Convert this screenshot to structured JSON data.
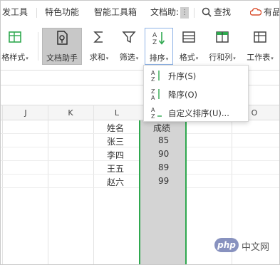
{
  "menubar": {
    "items": [
      "发工具",
      "特色功能",
      "智能工具箱",
      "文档助:"
    ],
    "more_glyph": "⋮",
    "search_label": "查找",
    "cloud_label": "有品"
  },
  "ribbon": {
    "tools": [
      {
        "label": "格样式",
        "caret": "▾",
        "icon": "table-style-icon"
      },
      {
        "label": "文档助手",
        "caret": "",
        "icon": "document-assistant-icon"
      },
      {
        "label": "求和",
        "caret": "▾",
        "icon": "sum-icon"
      },
      {
        "label": "筛选",
        "caret": "▾",
        "icon": "filter-icon"
      },
      {
        "label": "排序",
        "caret": "▾",
        "icon": "sort-icon"
      },
      {
        "label": "格式",
        "caret": "▾",
        "icon": "format-icon"
      },
      {
        "label": "行和列",
        "caret": "▾",
        "icon": "rows-columns-icon"
      },
      {
        "label": "工作表",
        "caret": "▾",
        "icon": "worksheet-icon"
      }
    ]
  },
  "sort_menu": {
    "items": [
      {
        "label": "升序(S)",
        "icon": "sort-ascending-icon"
      },
      {
        "label": "降序(O)",
        "icon": "sort-descending-icon"
      },
      {
        "label": "自定义排序(U)...",
        "icon": "custom-sort-icon"
      }
    ]
  },
  "sheet": {
    "columns": [
      "J",
      "K",
      "L",
      "M",
      "N",
      "O"
    ],
    "rows": [
      {
        "name": "姓名",
        "score": "成绩"
      },
      {
        "name": "张三",
        "score": "85"
      },
      {
        "name": "李四",
        "score": "90"
      },
      {
        "name": "王五",
        "score": "89"
      },
      {
        "name": "赵六",
        "score": "99"
      }
    ]
  },
  "colors": {
    "accent_green": "#2fa84f",
    "selected_fill": "#d4d4d4",
    "highlight_fill": "#c8c8c8"
  },
  "watermark": {
    "logo": "php",
    "text": "中文网"
  }
}
